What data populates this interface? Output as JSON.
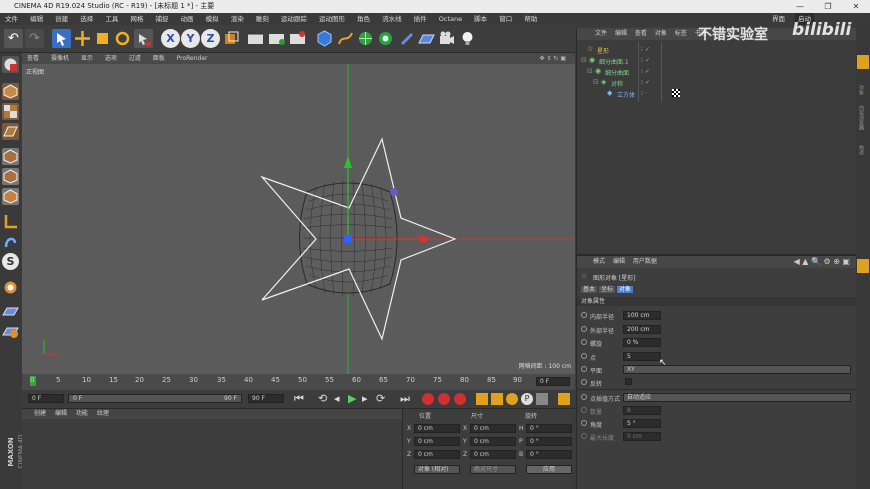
{
  "window": {
    "title": "CINEMA 4D R19.024 Studio (RC - R19) - [未标题 1 *] - 主要",
    "buttons": [
      "—",
      "❐",
      "✕"
    ]
  },
  "menu": [
    "文件",
    "编辑",
    "创建",
    "选择",
    "工具",
    "网格",
    "捕捉",
    "动画",
    "模拟",
    "渲染",
    "雕刻",
    "运动跟踪",
    "运动图形",
    "角色",
    "流水线",
    "插件",
    "Octane",
    "脚本",
    "窗口",
    "帮助"
  ],
  "layout": {
    "label": "界面",
    "value": "启动"
  },
  "watermark": {
    "text": "不错实验室",
    "logo": "bilibili"
  },
  "viewport": {
    "menu": [
      "查看",
      "摄像机",
      "显示",
      "选项",
      "过滤",
      "面板",
      "ProRender"
    ],
    "name": "正视图",
    "grid_spacing": "网格间距 : 100 cm"
  },
  "timeline": {
    "ticks": [
      "0",
      "5",
      "10",
      "15",
      "20",
      "25",
      "30",
      "35",
      "40",
      "45",
      "50",
      "55",
      "60",
      "65",
      "70",
      "75",
      "80",
      "85",
      "90"
    ],
    "frame_end_field": "0 F"
  },
  "transport": {
    "start": "0 F",
    "current": "0 F",
    "range_end": "90 F",
    "end": "90 F"
  },
  "material": {
    "menu": [
      "创建",
      "编辑",
      "功能",
      "纹理"
    ]
  },
  "coords": {
    "headers": [
      "位置",
      "尺寸",
      "旋转"
    ],
    "rows": [
      {
        "axis": "X",
        "pos": "0 cm",
        "sizeAxis": "X",
        "size": "0 cm",
        "rotAxis": "H",
        "rot": "0 °"
      },
      {
        "axis": "Y",
        "pos": "0 cm",
        "sizeAxis": "Y",
        "size": "0 cm",
        "rotAxis": "P",
        "rot": "0 °"
      },
      {
        "axis": "Z",
        "pos": "0 cm",
        "sizeAxis": "Z",
        "size": "0 cm",
        "rotAxis": "B",
        "rot": "0 °"
      }
    ],
    "mode": "对象 (相对)",
    "size_mode": "绝对尺寸",
    "apply": "应用"
  },
  "object_manager": {
    "menu": [
      "文件",
      "编辑",
      "查看",
      "对象",
      "标签",
      "书签"
    ],
    "items": [
      {
        "name": "星形",
        "depth": 0,
        "color": "#e8c34a"
      },
      {
        "name": "细分曲面.1",
        "depth": 0,
        "color": "#7fd07f"
      },
      {
        "name": "细分曲面",
        "depth": 1,
        "color": "#7fd07f"
      },
      {
        "name": "对称",
        "depth": 2,
        "color": "#7fd07f"
      },
      {
        "name": "立方体",
        "depth": 3,
        "color": "#7fb4ff"
      }
    ]
  },
  "attributes": {
    "menu": [
      "模式",
      "编辑",
      "用户数据"
    ],
    "object_title": "图形对象 [星形]",
    "tabs": [
      "基本",
      "坐标",
      "对象"
    ],
    "active_tab": "对象",
    "section": "对象属性",
    "fields": [
      {
        "label": "内部半径",
        "value": "100 cm"
      },
      {
        "label": "外部半径",
        "value": "200 cm"
      },
      {
        "label": "螺旋",
        "value": "0 %"
      },
      {
        "label": "点",
        "value": "5"
      },
      {
        "label": "平面",
        "value": "XY"
      },
      {
        "label": "反转",
        "value": ""
      },
      {
        "label": "点插值方式",
        "value": "自动适应"
      },
      {
        "label": "数量",
        "value": "8"
      },
      {
        "label": "角度",
        "value": "5 °"
      },
      {
        "label": "最大长度",
        "value": "5 cm"
      }
    ]
  },
  "side_tabs": [
    "对象",
    "内容浏览器",
    "构造"
  ],
  "brand": {
    "top": "MAXON",
    "bottom": "CINEMA 4D"
  },
  "colors": {
    "x_axis": "#e03030",
    "y_axis": "#30c030",
    "z_axis": "#3060ff",
    "spline": "#f0f0f0",
    "mesh": "#2a2a2a"
  }
}
